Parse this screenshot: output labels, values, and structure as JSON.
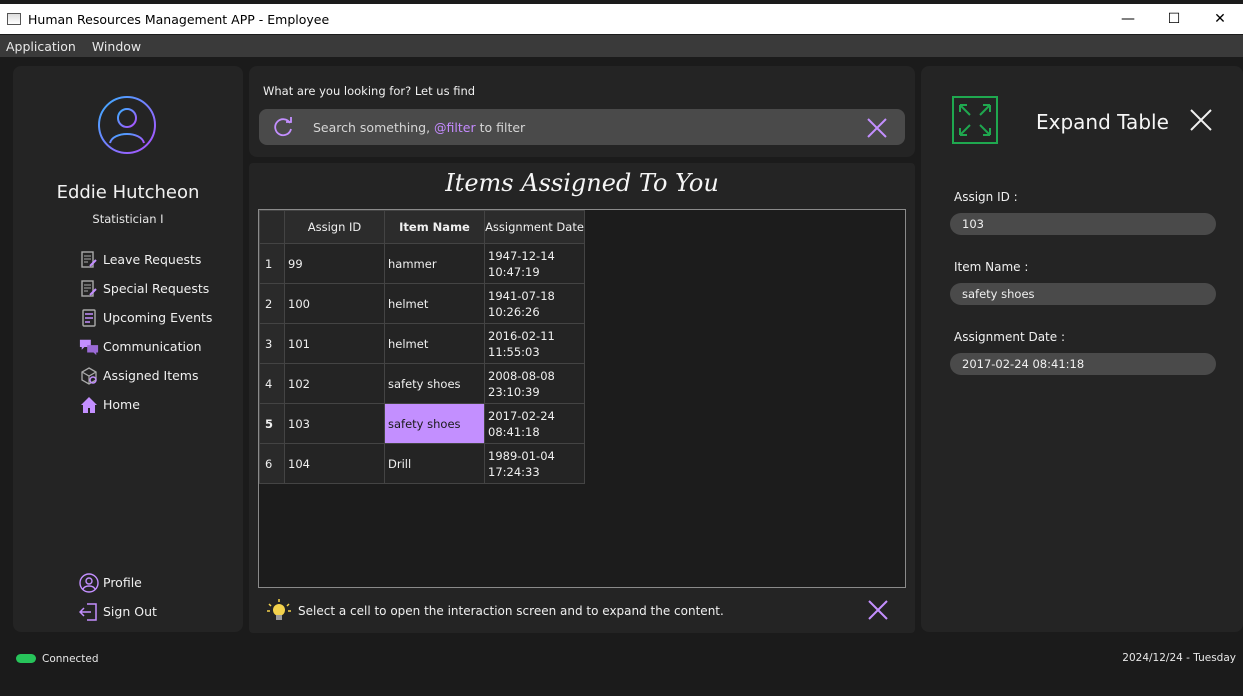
{
  "window": {
    "title": "Human Resources Management APP - Employee",
    "minimize": "—",
    "maximize": "☐",
    "close": "✕"
  },
  "menubar": {
    "items": [
      "Application",
      "Window"
    ]
  },
  "profile": {
    "name": "Eddie Hutcheon",
    "role": "Statistician I"
  },
  "nav": {
    "items": [
      {
        "label": "Leave Requests",
        "icon": "leave-requests-icon"
      },
      {
        "label": "Special Requests",
        "icon": "special-requests-icon"
      },
      {
        "label": "Upcoming Events",
        "icon": "upcoming-events-icon"
      },
      {
        "label": "Communication",
        "icon": "communication-icon"
      },
      {
        "label": "Assigned Items",
        "icon": "assigned-items-icon"
      },
      {
        "label": "Home",
        "icon": "home-icon"
      }
    ],
    "bottom": [
      {
        "label": "Profile",
        "icon": "profile-icon"
      },
      {
        "label": "Sign Out",
        "icon": "sign-out-icon"
      }
    ]
  },
  "search": {
    "hint": "What are you looking for? Let us find",
    "placeholder_prefix": "Search something, ",
    "placeholder_keyword": "@filter",
    "placeholder_suffix": " to filter"
  },
  "table": {
    "title": "Items Assigned To You",
    "columns": [
      "Assign ID",
      "Item Name",
      "Assignment Date"
    ],
    "rows": [
      {
        "num": "1",
        "id": "99",
        "name": "hammer",
        "date1": "1947-12-14",
        "date2": "10:47:19"
      },
      {
        "num": "2",
        "id": "100",
        "name": "helmet",
        "date1": "1941-07-18",
        "date2": "10:26:26"
      },
      {
        "num": "3",
        "id": "101",
        "name": "helmet",
        "date1": "2016-02-11",
        "date2": "11:55:03"
      },
      {
        "num": "4",
        "id": "102",
        "name": "safety shoes",
        "date1": "2008-08-08",
        "date2": "23:10:39"
      },
      {
        "num": "5",
        "id": "103",
        "name": "safety shoes",
        "date1": "2017-02-24",
        "date2": "08:41:18"
      },
      {
        "num": "6",
        "id": "104",
        "name": "Drill",
        "date1": "1989-01-04",
        "date2": "17:24:33"
      }
    ],
    "selected_row": 5,
    "selected_column": "Item Name",
    "tip": "Select a cell to open the interaction screen and to expand the content."
  },
  "details": {
    "title": "Expand Table",
    "fields": [
      {
        "label": "Assign ID :",
        "value": "103"
      },
      {
        "label": "Item Name :",
        "value": "safety shoes"
      },
      {
        "label": "Assignment Date :",
        "value": "2017-02-24 08:41:18"
      }
    ]
  },
  "status": {
    "connection": "Connected",
    "date": "2024/12/24 - Tuesday"
  },
  "colors": {
    "accent": "#c38fff",
    "success": "#27c45a",
    "expand_border": "#1fa84f"
  }
}
